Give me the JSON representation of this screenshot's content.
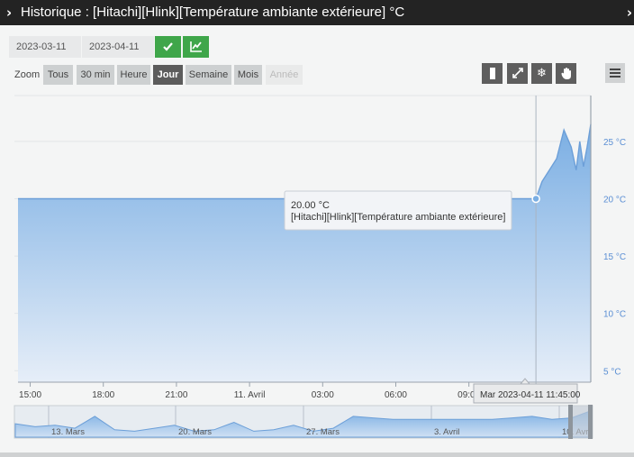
{
  "window": {
    "title": "Historique : [Hitachi][Hlink][Température ambiante extérieure] °C"
  },
  "range": {
    "start": "2023-03-11",
    "end": "2023-04-11"
  },
  "zoom": {
    "label": "Zoom",
    "buttons": [
      "Tous",
      "30 min",
      "Heure",
      "Jour",
      "Semaine",
      "Mois",
      "Année"
    ],
    "active": "Jour",
    "disabled": [
      "Année"
    ]
  },
  "tooltip": {
    "value": "20.00 °C",
    "series": "[Hitachi][Hlink][Température ambiante extérieure]",
    "timestamp": "Mar 2023-04-11 11:45:00"
  },
  "colors": {
    "area_top": "#7aaee3",
    "area_bottom": "#e6eef8",
    "line": "#6c9fd8",
    "axis_label": "#5b8fd4",
    "ok_button": "#3fa64a"
  },
  "icons": {
    "apply": "check-icon",
    "chart": "chart-line-icon",
    "toolbar": [
      "column-icon",
      "compress-icon",
      "snowflake-icon",
      "hand-icon"
    ],
    "menu": "hamburger-icon"
  },
  "chart_data": {
    "type": "area",
    "x_ticks": [
      "15:00",
      "18:00",
      "21:00",
      "11. Avril",
      "03:00",
      "06:00",
      "09:00"
    ],
    "y_ticks": [
      "5 °C",
      "10 °C",
      "15 °C",
      "20 °C",
      "25 °C"
    ],
    "ylim": [
      4,
      29
    ],
    "x_range_hours": [
      -9.5,
      14
    ],
    "series": [
      {
        "x_hours": [
          -9.5,
          11.75,
          12.0,
          12.3,
          12.6,
          12.9,
          13.2,
          13.4,
          13.55,
          13.7,
          13.85,
          14.0
        ],
        "values": [
          20.0,
          20.0,
          21.5,
          22.5,
          23.5,
          26.0,
          24.5,
          22.5,
          25.0,
          22.8,
          24.5,
          26.5
        ]
      }
    ],
    "navigator": {
      "labels": [
        "13. Mars",
        "20. Mars",
        "27. Mars",
        "3. Avril",
        "10. Avril"
      ],
      "values": [
        17,
        15,
        16,
        14,
        22,
        13,
        12,
        14,
        16,
        12,
        13,
        18,
        12,
        13,
        16,
        12,
        14,
        22,
        21,
        20,
        20,
        20,
        20,
        20,
        20,
        21,
        22,
        20,
        21,
        26
      ]
    }
  }
}
